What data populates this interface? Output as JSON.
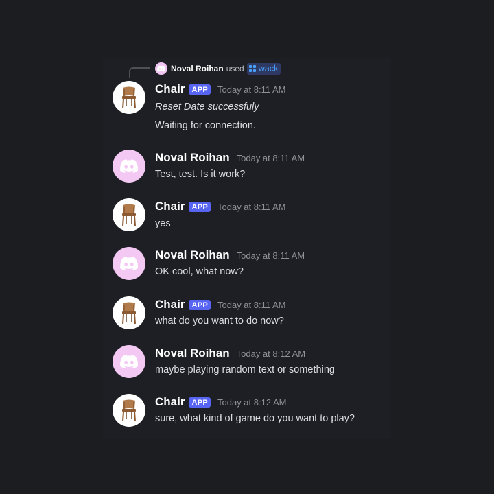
{
  "command": {
    "user": "Noval Roihan",
    "used_label": "used",
    "command_name": "wack"
  },
  "messages": [
    {
      "author": "Chair",
      "is_app": true,
      "app_label": "APP",
      "time": "Today at 8:11 AM",
      "lines": [
        "Reset Date successfuly",
        "Waiting for connection."
      ]
    },
    {
      "author": "Noval Roihan",
      "is_app": false,
      "time": "Today at 8:11 AM",
      "lines": [
        "Test, test. Is it work?"
      ]
    },
    {
      "author": "Chair",
      "is_app": true,
      "app_label": "APP",
      "time": "Today at 8:11 AM",
      "lines": [
        "yes"
      ]
    },
    {
      "author": "Noval Roihan",
      "is_app": false,
      "time": "Today at 8:11 AM",
      "lines": [
        "OK cool, what now?"
      ]
    },
    {
      "author": "Chair",
      "is_app": true,
      "app_label": "APP",
      "time": "Today at 8:11 AM",
      "lines": [
        "what do you want to do now?"
      ]
    },
    {
      "author": "Noval Roihan",
      "is_app": false,
      "time": "Today at 8:12 AM",
      "lines": [
        "maybe playing random text or something"
      ]
    },
    {
      "author": "Chair",
      "is_app": true,
      "app_label": "APP",
      "time": "Today at 8:12 AM",
      "lines": [
        "sure, what kind of game do you want to play?"
      ]
    }
  ],
  "colors": {
    "background": "#1c1d21",
    "app_tag": "#5865f2",
    "command_pill": "#4aa3ff",
    "discord_avatar": "#f3c9f4"
  },
  "icons": {
    "chair_avatar": "chair-icon",
    "user_avatar": "discord-logo-icon",
    "command": "app-command-icon"
  }
}
